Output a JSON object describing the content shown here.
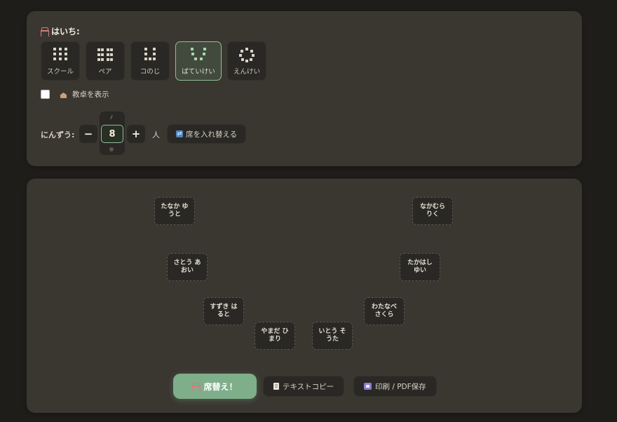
{
  "settings": {
    "layout_label": "はいち:",
    "layouts": [
      {
        "label": "スクール",
        "icon": "grid-school-icon",
        "selected": false
      },
      {
        "label": "ペア",
        "icon": "grid-pair-icon",
        "selected": false
      },
      {
        "label": "コのじ",
        "icon": "ko-shape-icon",
        "selected": false
      },
      {
        "label": "ばていけい",
        "icon": "u-shape-icon",
        "selected": true
      },
      {
        "label": "えんけい",
        "icon": "circle-shape-icon",
        "selected": false
      }
    ],
    "podium_label": "教卓を表示",
    "podium_checked": false,
    "count_label": "にんずう:",
    "minus_label": "−",
    "count_value": "8",
    "plus_label": "+",
    "unit_label": "人",
    "shuffle_label": "席を入れ替える",
    "shuffle_icon": "🔄"
  },
  "seats": [
    {
      "name": "たなか ゆうと"
    },
    {
      "name": "なかむら りく"
    },
    {
      "name": "さとう あおい"
    },
    {
      "name": "たかはし ゆい"
    },
    {
      "name": "すずき はると"
    },
    {
      "name": "わたなべ さくら"
    },
    {
      "name": "やまだ ひまり"
    },
    {
      "name": "いとう そうた"
    }
  ],
  "actions": {
    "shuffle_seats_label": "席替え！",
    "copy_text_label": "テキストコピー",
    "print_label": "印刷 / PDF保存"
  },
  "colors": {
    "background": "#1e1d1a",
    "panel": "#3a3731",
    "accent": "#7fae8a",
    "selected_border": "#8fbf98"
  }
}
